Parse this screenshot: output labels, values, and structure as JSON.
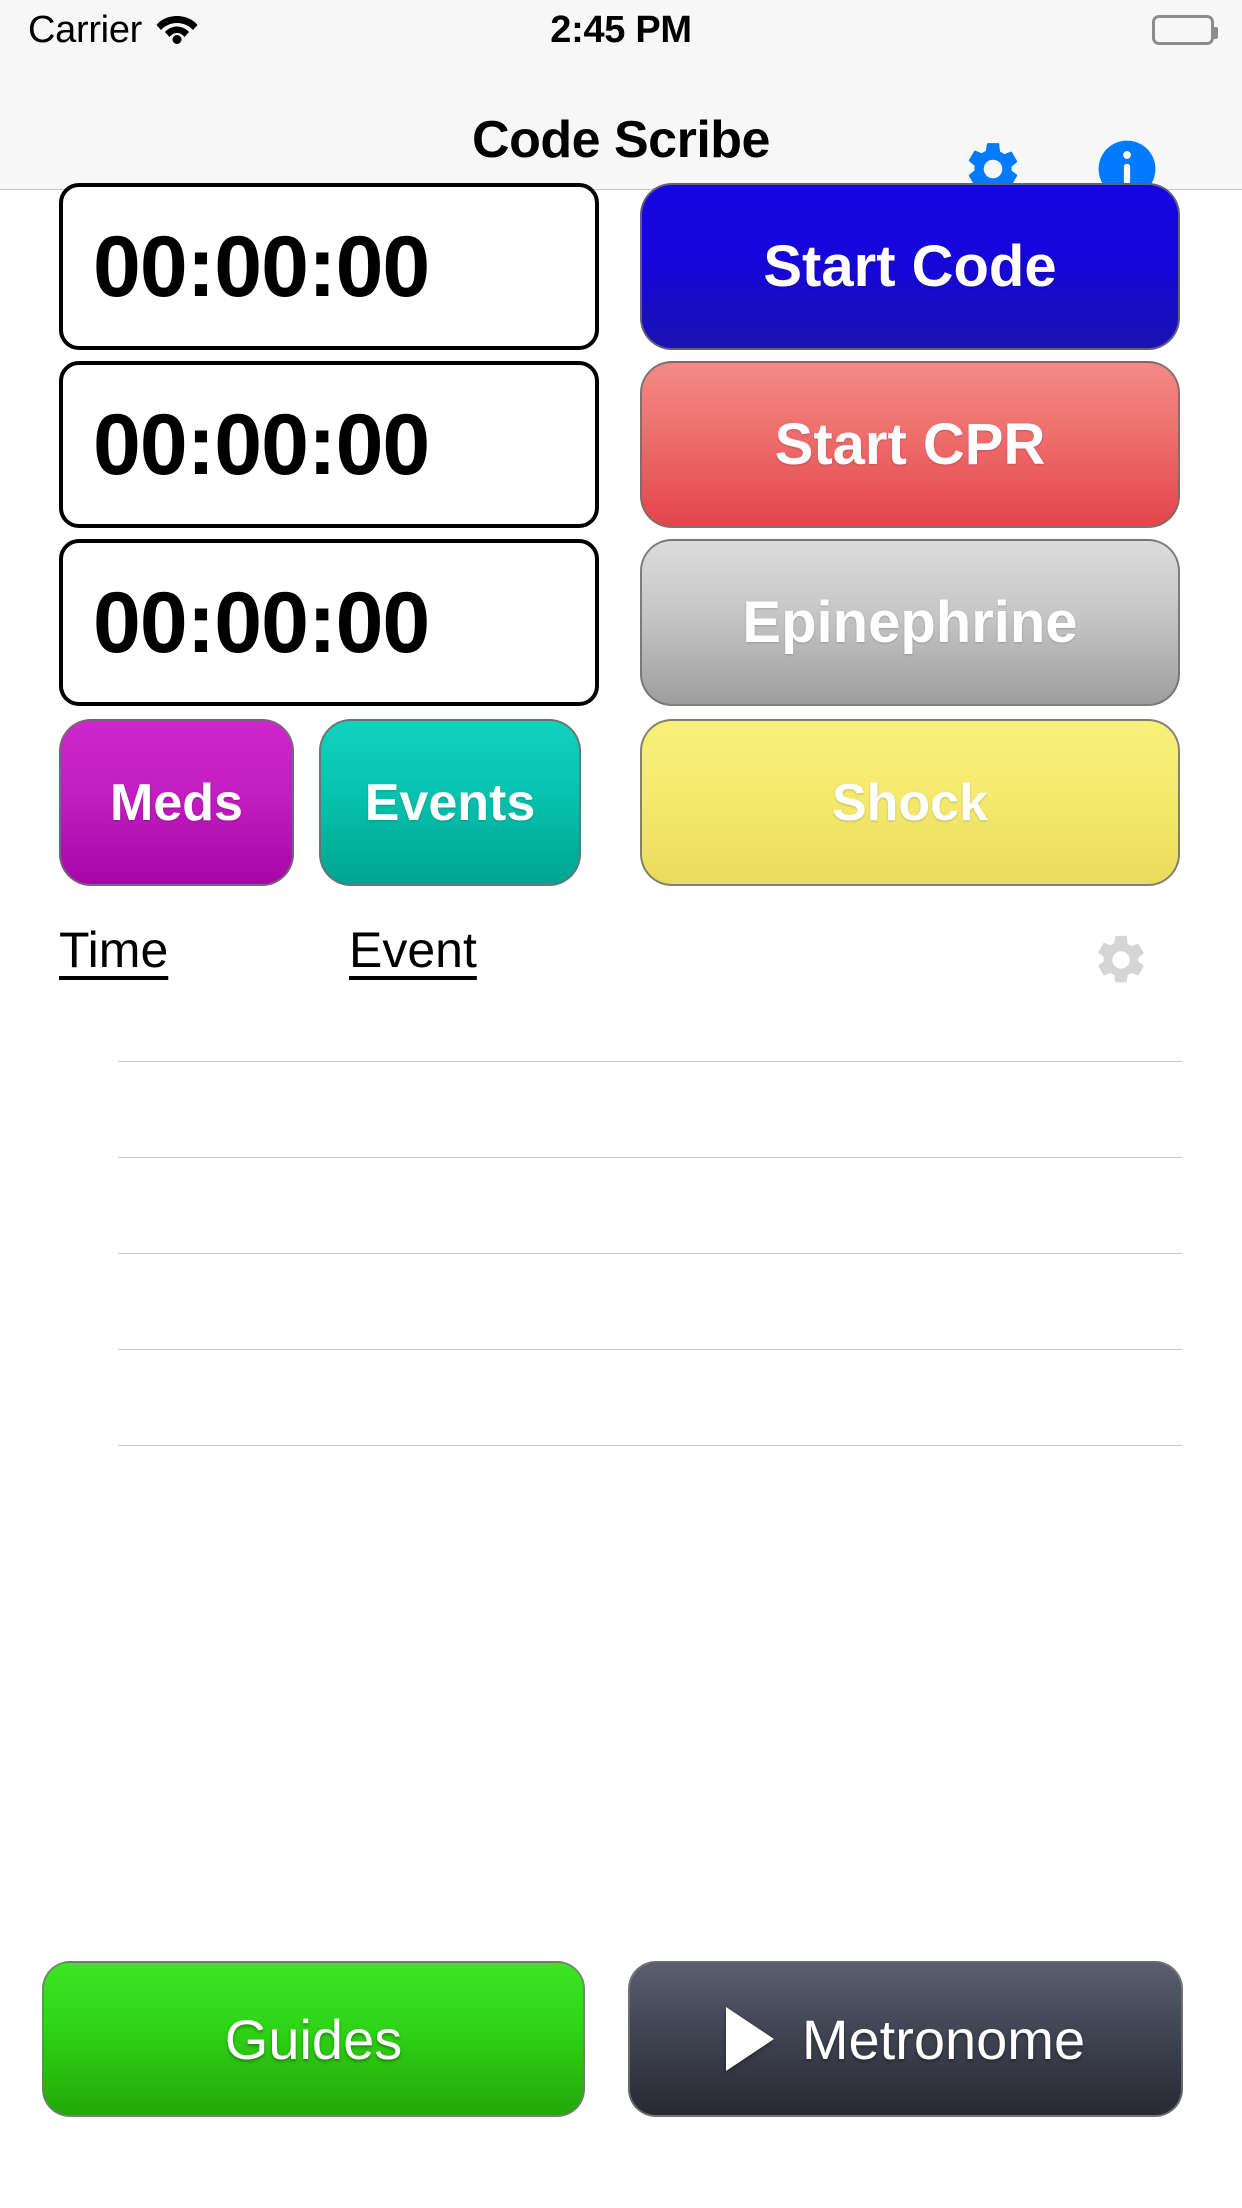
{
  "status_bar": {
    "carrier": "Carrier",
    "wifi_icon": "wifi-icon",
    "time": "2:45 PM",
    "battery_icon": "battery-full-icon"
  },
  "nav_bar": {
    "title": "Code Scribe",
    "gear_icon": "gear-icon",
    "info_icon": "info-circle-icon",
    "icon_color": "#007AFF"
  },
  "timers": [
    {
      "value": "00:00:00",
      "action_label": "Start Code",
      "action_color": "#1606DC"
    },
    {
      "value": "00:00:00",
      "action_label": "Start CPR",
      "action_color": "#EE716F"
    },
    {
      "value": "00:00:00",
      "action_label": "Epinephrine",
      "action_color": "#C6C6C6"
    }
  ],
  "quick_actions": {
    "meds_label": "Meds",
    "meds_color": "#C21EC0",
    "events_label": "Events",
    "events_color": "#07C2AE",
    "shock_label": "Shock",
    "shock_color": "#F5EA6E"
  },
  "log": {
    "column_time": "Time",
    "column_event": "Event",
    "settings_icon": "gear-icon",
    "rows": []
  },
  "footer": {
    "guides_label": "Guides",
    "guides_color": "#2FD417",
    "metronome_label": "Metronome",
    "metronome_color": "#414452",
    "metronome_icon": "play-icon"
  }
}
